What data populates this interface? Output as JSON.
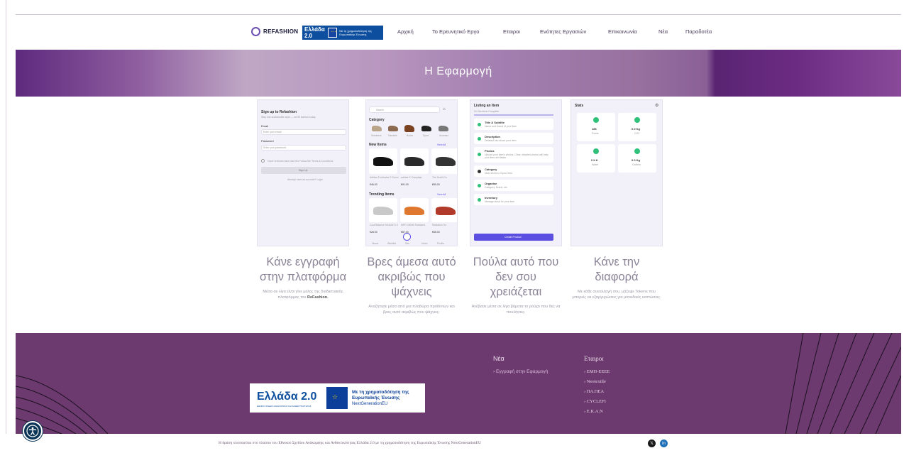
{
  "header": {
    "logo_text": "REFASHION",
    "gr_badge_title": "Ελλάδα 2.0",
    "gr_badge_sub": "Με τη χρηματοδότηση της Ευρωπαϊκής Ένωσης",
    "nav": [
      {
        "label": "Αρχική",
        "active": false
      },
      {
        "label": "Το Ερευνητικό Εργο",
        "active": false
      },
      {
        "label": "Εταιροι",
        "active": false
      },
      {
        "label": "Ενότητες Εργασιών",
        "active": false
      },
      {
        "label": "Επικοινωνία",
        "active": false
      },
      {
        "label": "Νέα",
        "active": false
      },
      {
        "label": "Παραδοτέα",
        "active": true
      }
    ]
  },
  "banner": {
    "title": "Η Εφαρμογή"
  },
  "cards": [
    {
      "title": "Κάνε εγγραφή στην πλατφόρμα",
      "desc_pre": "Μέσα σε λίγα είναι γίνε μέλος της διαδικτυακής πλατφόρμας του",
      "desc_bold": "ReFashion.",
      "screen": {
        "heading": "Sign up to Refashion",
        "sub": "Step into sustainable style — we fill fashion today",
        "email_label": "Email",
        "email_placeholder": "Enter your email",
        "password_label": "Password",
        "password_placeholder": "Enter your password",
        "terms": "I have reviewed and read the Follow the Terms & Conditions",
        "button": "Sign Up",
        "login": "Already have an account? Login"
      }
    },
    {
      "title": "Βρες άμεσα αυτό ακριβώς που ψάχνεις",
      "desc_pre": "Αναζήτησε μέσα από μια πληθώρα προϊόντων και βρες αυτό ακριβώς που ψάχνεις.",
      "desc_bold": "",
      "screen": {
        "search": "Search",
        "category": "Category",
        "cats": [
          "Sneakers",
          "Sandals",
          "Boots",
          "Sport",
          "Accesso"
        ],
        "new_items": "New Items",
        "view_all": "View All",
        "items": [
          {
            "name": "Adidas Forbhatuz 2 Runni",
            "price": "€46.00"
          },
          {
            "name": "adidas X Crazyfast",
            "price": "€91.00"
          },
          {
            "name": "The North Fa",
            "price": "€80.00"
          }
        ],
        "trending": "Trending Items",
        "trending_items": [
          {
            "name": "Cool Balance 9K/A0671 0",
            "price": "€28.00"
          },
          {
            "name": "MPR 28005 Sneakers",
            "price": "€87.00"
          },
          {
            "name": "Radiation Su",
            "price": "€65.00"
          }
        ],
        "tabs": [
          "Home",
          "Wishlist",
          "Sell",
          "Inbox",
          "Profile"
        ]
      }
    },
    {
      "title": "Πούλα αυτό που δεν σου χρειάζεται",
      "desc_pre": "Ανέβασε μέσα σε λίγα βήματα το ρούχο που θες να πουλήσεις.",
      "desc_bold": "",
      "screen": {
        "heading": "Listing an Item",
        "progress": "0/4 Sections Complete",
        "rows": [
          {
            "title": "Title & Subtitle",
            "sub": "Name and brand of your item",
            "done": true
          },
          {
            "title": "Description",
            "sub": "Detailed info about your item",
            "done": true
          },
          {
            "title": "Photos",
            "sub": "Upload your item's photos. Clear, detailed photos will help your item sell faster",
            "done": true
          },
          {
            "title": "Category",
            "sub": "Main section of your item",
            "done": false
          },
          {
            "title": "Organise",
            "sub": "Category, Brand, etc",
            "done": true
          },
          {
            "title": "Inventory",
            "sub": "Manage stock for your item",
            "done": true
          }
        ],
        "button": "Create Product"
      }
    },
    {
      "title": "Κάνε την διαφορά",
      "desc_pre": "Με κάθε συναλλαγή σου, μάζεψε Tokens που μπορείς να εξαργυρώσεις για μοναδικές εκπτώσεις.",
      "desc_bold": "",
      "screen": {
        "heading": "Stats",
        "stats": [
          {
            "value": "186",
            "label": "Points",
            "color": "#c49a2e"
          },
          {
            "value": "0.0 Kg",
            "label": "CO2",
            "color": "#9b4fd0"
          },
          {
            "value": "0 lt 8",
            "label": "Water",
            "color": "#3b5cc4"
          },
          {
            "value": "0.0 Kg",
            "label": "Clothes",
            "color": "#777777"
          }
        ]
      }
    }
  ],
  "footer": {
    "news_title": "Νέα",
    "news_links": [
      "Εγγραφή στην Εφαρμογή"
    ],
    "partners_title": "Εταιροι",
    "partners_links": [
      "ΕΜΠ-ΕΕΕΕ",
      "Neotextile",
      "ΠΑ.ΠΕΑ",
      "CYCLEFI",
      "Ε.Κ.Α.Ν"
    ],
    "funding_title": "Ελλάδα 2.0",
    "funding_sub": "ΕΘΝΙΚΟ ΣΧΕΔΙΟ ΑΝΑΚΑΜΨΗΣ ΚΑΙ ΑΝΘΕΚΤΙΚΟΤΗΤΑΣ",
    "funding_text": "Με τη χρηματοδότηση της Ευρωπαϊκής Ένωσης",
    "funding_ng": "NextGenerationEU",
    "copyright": "Η δράση υλοποιείται στο πλαίσιο του Εθνικού Σχεδίου Ανάκαμψης και Ανθεκτικότητας Ελλάδα 2.0 με τη χρηματοδότηση της Ευρωπαϊκής Ένωσης NextGenerationEU",
    "social": [
      "x-icon",
      "linkedin-icon"
    ]
  },
  "colors": {
    "accent": "#6c3a6e",
    "link": "#7a3e9c",
    "button": "#5a4fe0"
  }
}
